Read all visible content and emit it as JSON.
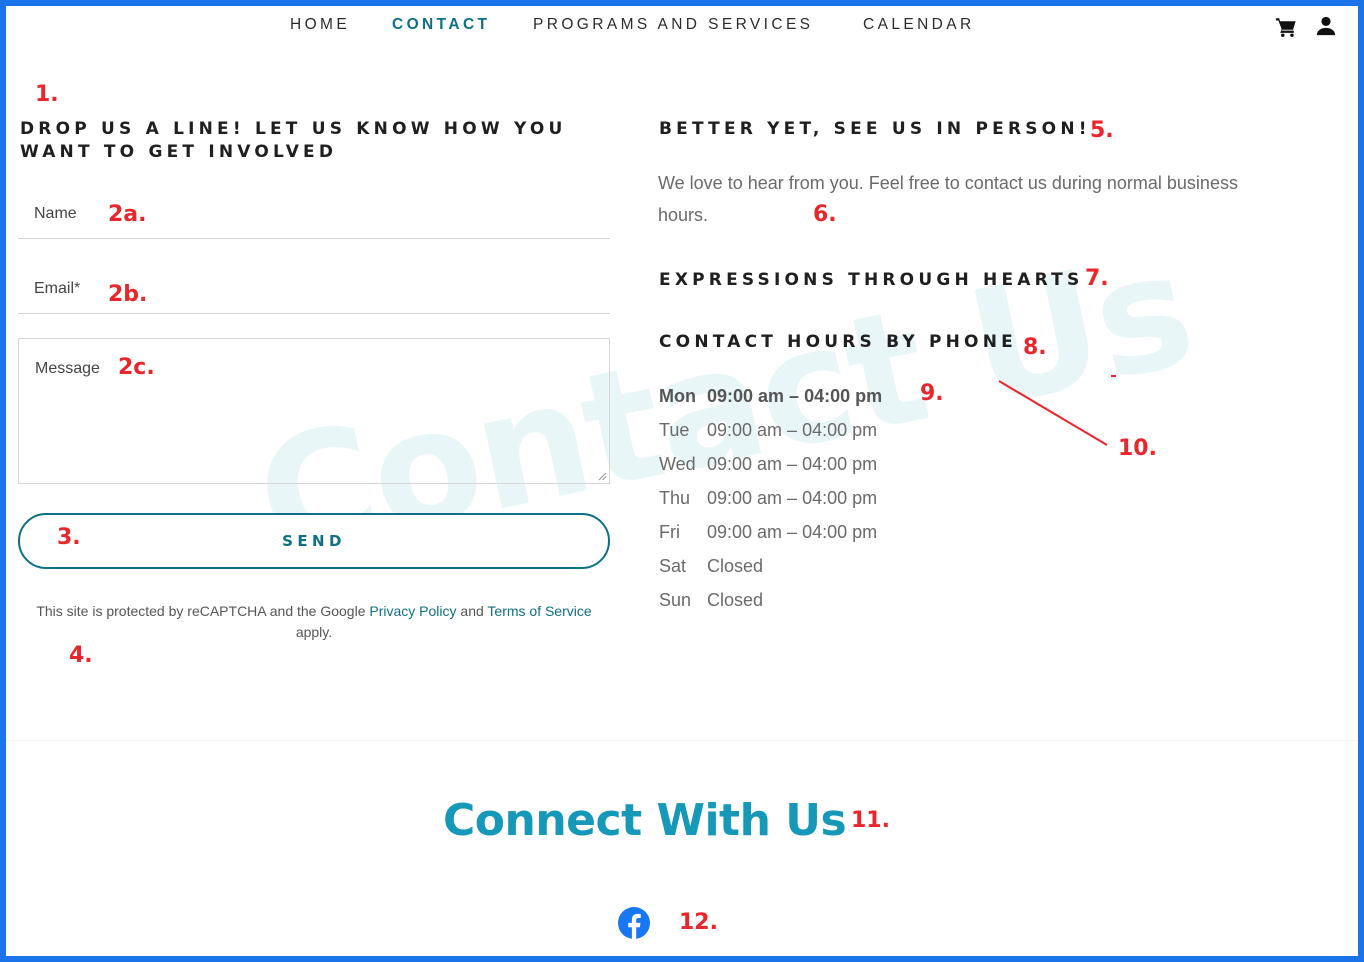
{
  "nav": {
    "items": [
      "HOME",
      "CONTACT",
      "PROGRAMS AND SERVICES",
      "CALENDAR"
    ],
    "active": "CONTACT",
    "cart_icon": "cart-icon",
    "user_icon": "user-icon"
  },
  "watermark": "Contact Us",
  "form": {
    "heading": "DROP US A LINE! LET US KNOW HOW YOU WANT TO GET INVOLVED",
    "name_placeholder": "Name",
    "email_placeholder": "Email*",
    "message_placeholder": "Message",
    "send_label": "SEND",
    "recaptcha": {
      "prefix": "This site is protected by reCAPTCHA and the Google ",
      "privacy_link": "Privacy Policy",
      "middle": " and ",
      "terms_link": "Terms of Service",
      "suffix": " apply."
    }
  },
  "visit": {
    "heading": "BETTER YET, SEE US IN PERSON!",
    "text": "We love to hear from you. Feel free to contact us during normal business hours.",
    "org_name": "EXPRESSIONS THROUGH HEARTS",
    "hours_heading": "CONTACT HOURS BY PHONE",
    "hours": [
      {
        "day": "Mon",
        "time": "09:00 am – 04:00 pm"
      },
      {
        "day": "Tue",
        "time": "09:00 am – 04:00 pm"
      },
      {
        "day": "Wed",
        "time": "09:00 am – 04:00 pm"
      },
      {
        "day": "Thu",
        "time": "09:00 am – 04:00 pm"
      },
      {
        "day": "Fri",
        "time": "09:00 am – 04:00 pm"
      },
      {
        "day": "Sat",
        "time": "Closed"
      },
      {
        "day": "Sun",
        "time": "Closed"
      }
    ]
  },
  "footer": {
    "heading": "Connect With Us",
    "social_icon": "facebook-icon"
  },
  "annotations": [
    "1.",
    "2a.",
    "2b.",
    "2c.",
    "3.",
    "4.",
    "5.",
    "6.",
    "7.",
    "8.",
    "9.",
    "10.",
    "11.",
    "12."
  ],
  "colors": {
    "frame": "#1a73e8",
    "accent": "#0f6f86",
    "heading_blue": "#1698b8",
    "annotation_red": "#e8262b"
  }
}
